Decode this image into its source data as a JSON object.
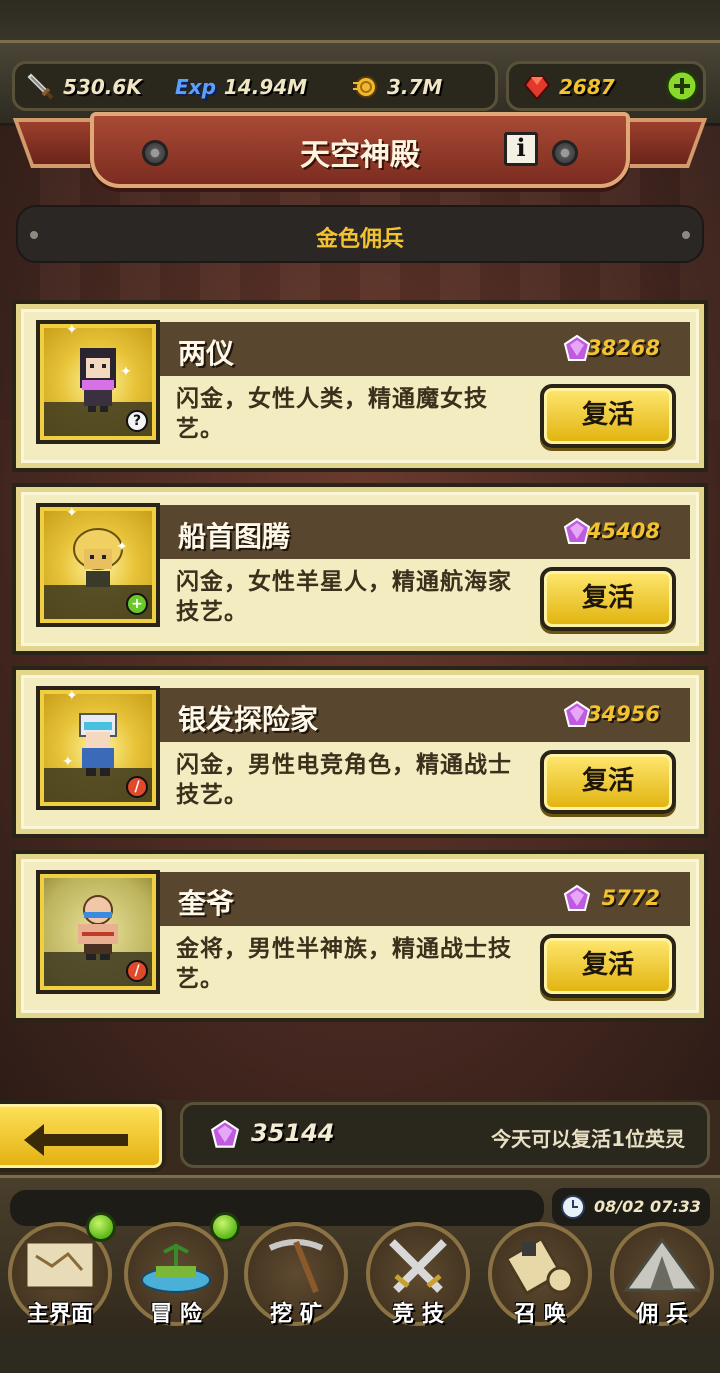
{
  "resources": {
    "attack": "530.6K",
    "exp_label": "Exp",
    "exp": "14.94M",
    "gold": "3.7M",
    "gems": "2687"
  },
  "header": {
    "title": "天空神殿",
    "info_label": "i"
  },
  "subtitle": "金色佣兵",
  "cards": [
    {
      "name": "两仪",
      "cost": "38268",
      "desc": "闪金，女性人类，精通魔女技艺。",
      "button": "复活",
      "badge": "?"
    },
    {
      "name": "船首图腾",
      "cost": "45408",
      "desc": "闪金，女性羊星人，精通航海家技艺。",
      "button": "复活",
      "badge": "+"
    },
    {
      "name": "银发探险家",
      "cost": "34956",
      "desc": "闪金，男性电竞角色，精通战士技艺。",
      "button": "复活",
      "badge": "/"
    },
    {
      "name": "奎爷",
      "cost": "5772",
      "desc": "金将，男性半神族，精通战士技艺。",
      "button": "复活",
      "badge": "/"
    }
  ],
  "footer_status": {
    "gem_count": "35144",
    "note": "今天可以复活1位英灵"
  },
  "clock": "08/02 07:33",
  "nav": [
    {
      "label": "主界面",
      "icon": "map-scroll-icon"
    },
    {
      "label": "冒 险",
      "icon": "island-icon"
    },
    {
      "label": "挖 矿",
      "icon": "pickaxe-icon"
    },
    {
      "label": "竞 技",
      "icon": "crossed-swords-icon"
    },
    {
      "label": "召 唤",
      "icon": "summon-scroll-icon"
    },
    {
      "label": "佣 兵",
      "icon": "tent-icon"
    }
  ],
  "colors": {
    "accent_gold": "#f2c230",
    "card_bg": "#f2ecc0",
    "banner_red": "#a84a35",
    "gem_purple": "#b24ad8",
    "notify_green": "#5cb81a"
  }
}
